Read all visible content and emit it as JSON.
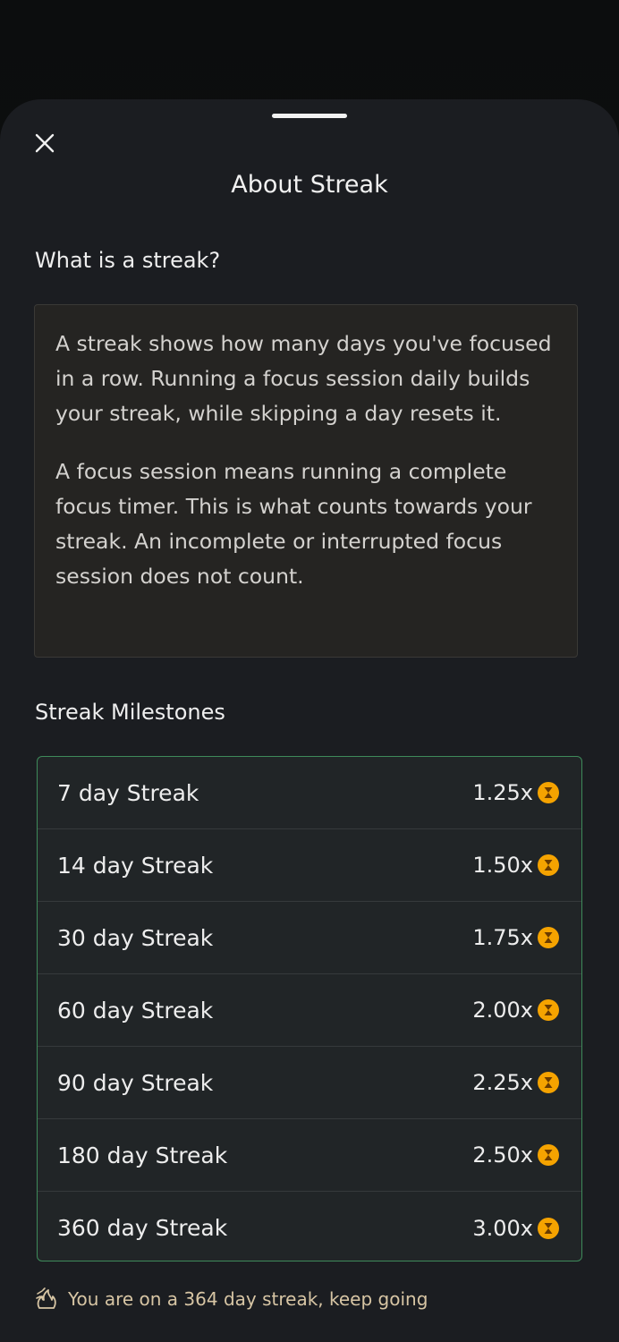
{
  "sheet": {
    "title": "About Streak"
  },
  "what_is": {
    "heading": "What is a streak?",
    "paragraph1": "A streak shows how many days you've focused in a row. Running a focus session daily builds your streak, while skipping a day resets it.",
    "paragraph2": "A focus session means running a complete focus timer. This is what counts towards your streak. An incomplete or interrupted focus session does not count."
  },
  "milestones": {
    "heading": "Streak Milestones",
    "rows": [
      {
        "label": "7 day Streak",
        "multiplier": "1.25x"
      },
      {
        "label": "14 day Streak",
        "multiplier": "1.50x"
      },
      {
        "label": "30 day Streak",
        "multiplier": "1.75x"
      },
      {
        "label": "60 day Streak",
        "multiplier": "2.00x"
      },
      {
        "label": "90 day Streak",
        "multiplier": "2.25x"
      },
      {
        "label": "180 day Streak",
        "multiplier": "2.50x"
      },
      {
        "label": "360 day Streak",
        "multiplier": "3.00x"
      }
    ]
  },
  "footer": {
    "status": "You are on a 364 day streak, keep going"
  },
  "icons": {
    "close": "close-icon",
    "coin": "hourglass-coin-icon",
    "flame": "flame-icon"
  },
  "colors": {
    "sheet_bg": "#1b1d21",
    "card_bg": "#252422",
    "milestone_border": "#3e8a5a",
    "coin": "#f5a300",
    "footer_text": "#d7c5a4"
  }
}
